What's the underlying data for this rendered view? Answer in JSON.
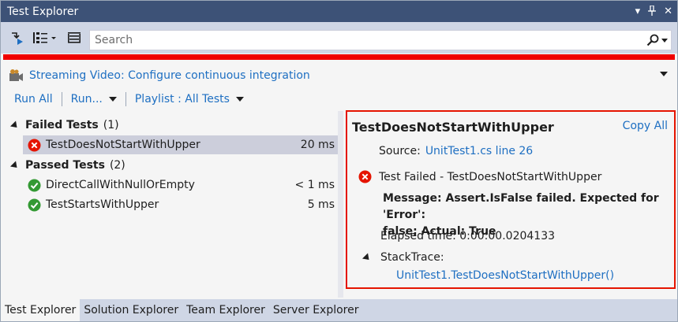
{
  "window": {
    "title": "Test Explorer",
    "controls": {
      "dropdown": "▾",
      "pin": "📌",
      "close": "✕"
    }
  },
  "toolbar": {
    "search_placeholder": "Search"
  },
  "streaming": {
    "label": "Streaming Video: Configure continuous integration"
  },
  "commands": {
    "run_all": "Run All",
    "run": "Run...",
    "playlist": "Playlist : All Tests"
  },
  "groups": [
    {
      "name": "Failed Tests",
      "count": "(1)",
      "tests": [
        {
          "name": "TestDoesNotStartWithUpper",
          "duration": "20 ms",
          "status": "failed"
        }
      ]
    },
    {
      "name": "Passed Tests",
      "count": "(2)",
      "tests": [
        {
          "name": "DirectCallWithNullOrEmpty",
          "duration": "< 1 ms",
          "status": "passed"
        },
        {
          "name": "TestStartsWithUpper",
          "duration": "5 ms",
          "status": "passed"
        }
      ]
    }
  ],
  "detail": {
    "test_name": "TestDoesNotStartWithUpper",
    "copy_all": "Copy All",
    "source_label": "Source:",
    "source_link": "UnitTest1.cs line 26",
    "result": "Test Failed - TestDoesNotStartWithUpper",
    "message_line1": "Message: Assert.IsFalse failed. Expected for 'Error':",
    "message_line2": "false; Actual: True",
    "elapsed": "Elapsed time: 0:00:00.0204133",
    "stacktrace_label": "StackTrace:",
    "stack_frame": "UnitTest1.TestDoesNotStartWithUpper()"
  },
  "tabs": [
    "Test Explorer",
    "Solution Explorer",
    "Team Explorer",
    "Server Explorer"
  ],
  "colors": {
    "title_bar": "#3D5277",
    "fail_red": "#E51400",
    "pass_green": "#339933",
    "link_blue": "#1E6FC2"
  }
}
